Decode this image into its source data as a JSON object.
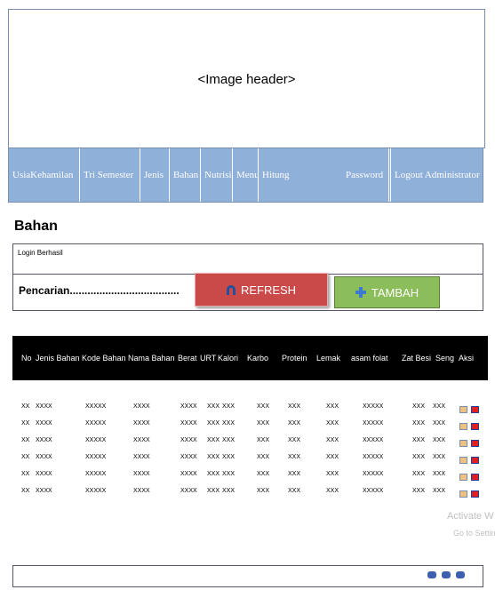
{
  "header": {
    "image_label": "<Image header>"
  },
  "nav": {
    "items": [
      "UsiaKehamilan",
      "Tri Semester",
      "Jenis",
      "Bahan",
      "Nutrisi",
      "Menu",
      "Hitung",
      "Password",
      "Logout Administrator"
    ]
  },
  "page": {
    "title": "Bahan"
  },
  "panel": {
    "message": "Login Berhasil",
    "search_label": "Pencarian.....................................",
    "refresh_label": "REFRESH",
    "tambah_label": "TAMBAH"
  },
  "table": {
    "columns": [
      "No",
      "Jenis Bahan",
      "Kode Bahan",
      "Nama Bahan",
      "Berat",
      "URT",
      "Kalori",
      "Karbo",
      "Protein",
      "Lemak",
      "asam folat",
      "Zat Besi",
      "Seng",
      "Aksi"
    ],
    "rows": [
      [
        "XX",
        "XXXX",
        "XXXXX",
        "XXXX",
        "XXXX",
        "XXX",
        "XXX",
        "XXX",
        "XXX",
        "XXX",
        "XXXXX",
        "XXX",
        "XXX"
      ],
      [
        "XX",
        "XXXX",
        "XXXXX",
        "XXXX",
        "XXXX",
        "XXX",
        "XXX",
        "XXX",
        "XXX",
        "XXX",
        "XXXXX",
        "XXX",
        "XXX"
      ],
      [
        "XX",
        "XXXX",
        "XXXXX",
        "XXXX",
        "XXXX",
        "XXX",
        "XXX",
        "XXX",
        "XXX",
        "XXX",
        "XXXXX",
        "XXX",
        "XXX"
      ],
      [
        "XX",
        "XXXX",
        "XXXXX",
        "XXXX",
        "XXXX",
        "XXX",
        "XXX",
        "XXX",
        "XXX",
        "XXX",
        "XXXXX",
        "XXX",
        "XXX"
      ],
      [
        "XX",
        "XXXX",
        "XXXXX",
        "XXXX",
        "XXXX",
        "XXX",
        "XXX",
        "XXX",
        "XXX",
        "XXX",
        "XXXXX",
        "XXX",
        "XXX"
      ],
      [
        "XX",
        "XXXX",
        "XXXXX",
        "XXXX",
        "XXXX",
        "XXX",
        "XXX",
        "XXX",
        "XXX",
        "XXX",
        "XXXXX",
        "XXX",
        "XXX"
      ]
    ]
  },
  "watermark": {
    "line1": "Activate W",
    "line2": "Go to Setting"
  },
  "colors": {
    "nav_bg": "#8fb0d8",
    "refresh_bg": "#c94a48",
    "tambah_bg": "#8bbd5a",
    "table_header_bg": "#000000",
    "delete_icon": "#e02020",
    "edit_icon": "#f0c080",
    "pagination": "#3c5fb0"
  }
}
